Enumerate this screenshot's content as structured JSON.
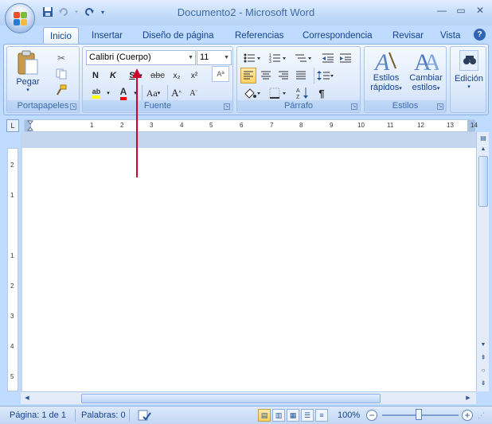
{
  "window": {
    "title": "Documento2 - Microsoft Word"
  },
  "tabs": [
    "Inicio",
    "Insertar",
    "Diseño de página",
    "Referencias",
    "Correspondencia",
    "Revisar",
    "Vista"
  ],
  "clipboard": {
    "paste_label": "Pegar",
    "group_label": "Portapapeles"
  },
  "font": {
    "name": "Calibri (Cuerpo)",
    "size": "11",
    "group_label": "Fuente",
    "bold": "N",
    "italic": "K",
    "underline": "S",
    "strike": "abc",
    "subscript": "x₂",
    "superscript": "x²",
    "change_case": "Aa",
    "grow": "A",
    "shrink": "A",
    "clear_format": "Aª",
    "highlight": "ab",
    "font_color": "A"
  },
  "paragraph": {
    "group_label": "Párrafo",
    "pilcrow": "¶"
  },
  "styles": {
    "group_label": "Estilos",
    "quick_styles_label1": "Estilos",
    "quick_styles_label2": "rápidos",
    "change_styles_label1": "Cambiar",
    "change_styles_label2": "estilos"
  },
  "editing": {
    "label": "Edición"
  },
  "ruler": {
    "h_numbers": [
      "1",
      "2",
      "3",
      "4",
      "5",
      "6",
      "7",
      "8",
      "9",
      "10",
      "11",
      "12",
      "13",
      "14"
    ],
    "v_numbers": [
      "2",
      "1",
      "1",
      "2",
      "3",
      "4",
      "5"
    ]
  },
  "status": {
    "page": "Página: 1 de 1",
    "words": "Palabras: 0",
    "zoom": "100%"
  },
  "colors": {
    "accent": "#15428b",
    "ribbon": "#dbe9fc",
    "arrow": "#d0002a",
    "highlight": "#ffff00",
    "font_color": "#ff0000"
  },
  "icons": [
    "office-button-icon",
    "save-icon",
    "undo-icon",
    "redo-icon",
    "help-icon",
    "paste-icon",
    "cut-icon",
    "copy-icon",
    "format-painter-icon",
    "find-icon"
  ]
}
